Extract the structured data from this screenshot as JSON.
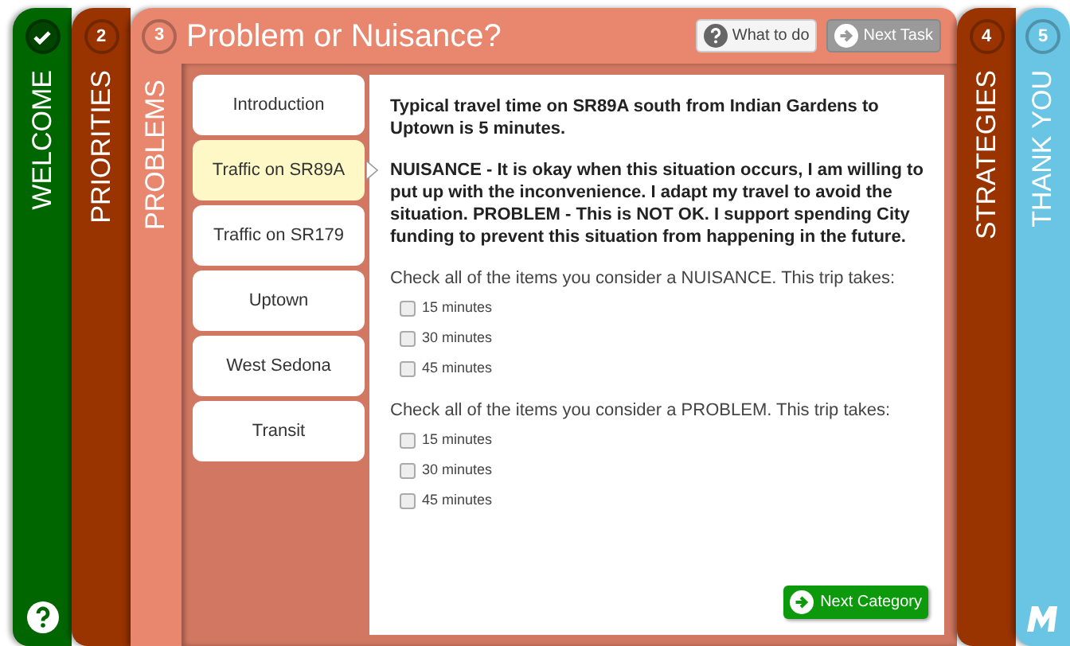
{
  "steps": [
    {
      "kind": "done",
      "label": "WELCOME",
      "color": "#006600",
      "selected": false
    },
    {
      "kind": "number",
      "number": "2",
      "label": "PRIORITIES",
      "color": "#993300",
      "selected": false
    },
    {
      "kind": "number",
      "number": "3",
      "label": "PROBLEMS",
      "color": "#e8866e",
      "selected": true
    },
    {
      "kind": "number",
      "number": "4",
      "label": "STRATEGIES",
      "color": "#993300",
      "selected": false
    },
    {
      "kind": "number",
      "number": "5",
      "label": "THANK YOU",
      "color": "#6ac4e4",
      "selected": false
    }
  ],
  "title": "Problem or Nuisance?",
  "header_buttons": [
    {
      "label": "What to do",
      "disabled": false
    },
    {
      "label": "Next Task",
      "disabled": true
    }
  ],
  "categories": [
    {
      "label": "Introduction",
      "selected": false
    },
    {
      "label": "Traffic on SR89A",
      "selected": true
    },
    {
      "label": "Traffic on SR179",
      "selected": false
    },
    {
      "label": "Uptown",
      "selected": false
    },
    {
      "label": "West Sedona",
      "selected": false
    },
    {
      "label": "Transit",
      "selected": false
    }
  ],
  "content": {
    "intro": "Typical travel time on SR89A south from Indian Gardens to Uptown is 5 minutes.",
    "definition": "NUISANCE - It is okay when this situation occurs, I am willing to put up with the inconvenience. I adapt my travel to avoid the situation. PROBLEM - This is NOT OK. I support spending City funding to prevent this situation from happening in the future.",
    "questions": [
      {
        "prompt": "Check all of the items you consider a NUISANCE. This trip takes:",
        "options": [
          {
            "label": "15 minutes",
            "checked": false
          },
          {
            "label": "30 minutes",
            "checked": false
          },
          {
            "label": "45 minutes",
            "checked": false
          }
        ]
      },
      {
        "prompt": "Check all of the items you consider a PROBLEM. This trip takes:",
        "options": [
          {
            "label": "15 minutes",
            "checked": false
          },
          {
            "label": "30 minutes",
            "checked": false
          },
          {
            "label": "45 minutes",
            "checked": false
          }
        ]
      }
    ],
    "next_button": "Next Category"
  }
}
